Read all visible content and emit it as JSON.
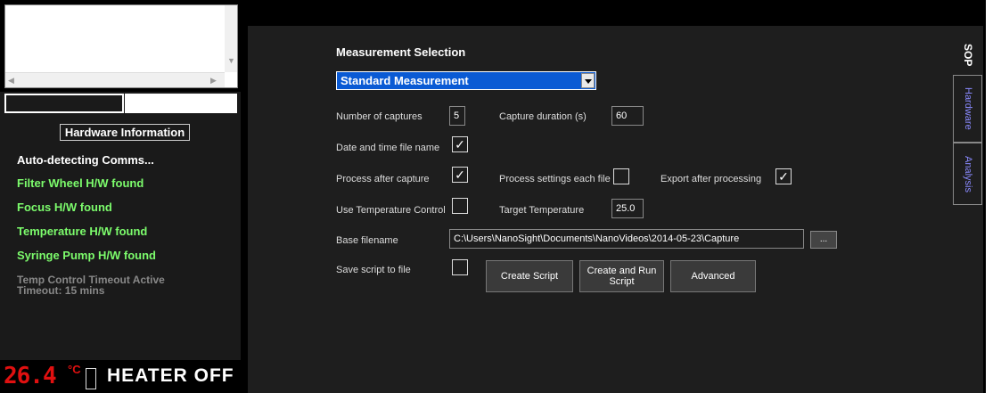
{
  "left": {
    "hardware_title": "Hardware Information",
    "status_lines": [
      "Auto-detecting Comms...",
      "Filter Wheel H/W found",
      "Focus H/W found",
      "Temperature H/W found",
      "Syringe Pump H/W found"
    ],
    "timeout_line1": "Temp Control Timeout Active",
    "timeout_line2": "Timeout: 15 mins",
    "temperature": "26.4",
    "temp_unit": "°C",
    "heater_status": "HEATER OFF"
  },
  "tabs": [
    "SOP",
    "Hardware",
    "Analysis"
  ],
  "measurement": {
    "title": "Measurement Selection",
    "selected": "Standard Measurement",
    "number_of_captures_label": "Number of captures",
    "number_of_captures": "5",
    "capture_duration_label": "Capture duration (s)",
    "capture_duration": "60",
    "date_time_label": "Date and time file name",
    "date_time_checked": true,
    "process_after_label": "Process after capture",
    "process_after_checked": true,
    "process_each_label": "Process settings each file",
    "process_each_checked": false,
    "export_after_label": "Export after processing",
    "export_after_checked": true,
    "use_temp_label": "Use Temperature Control",
    "use_temp_checked": false,
    "target_temp_label": "Target Temperature",
    "target_temp": "25.0",
    "base_filename_label": "Base filename",
    "base_filename": "C:\\Users\\NanoSight\\Documents\\NanoVideos\\2014-05-23\\Capture",
    "browse_label": "...",
    "save_script_label": "Save script to file",
    "save_script_checked": false,
    "create_script": "Create Script",
    "create_run_script": "Create and Run Script",
    "advanced": "Advanced"
  },
  "check_glyph": "✓"
}
